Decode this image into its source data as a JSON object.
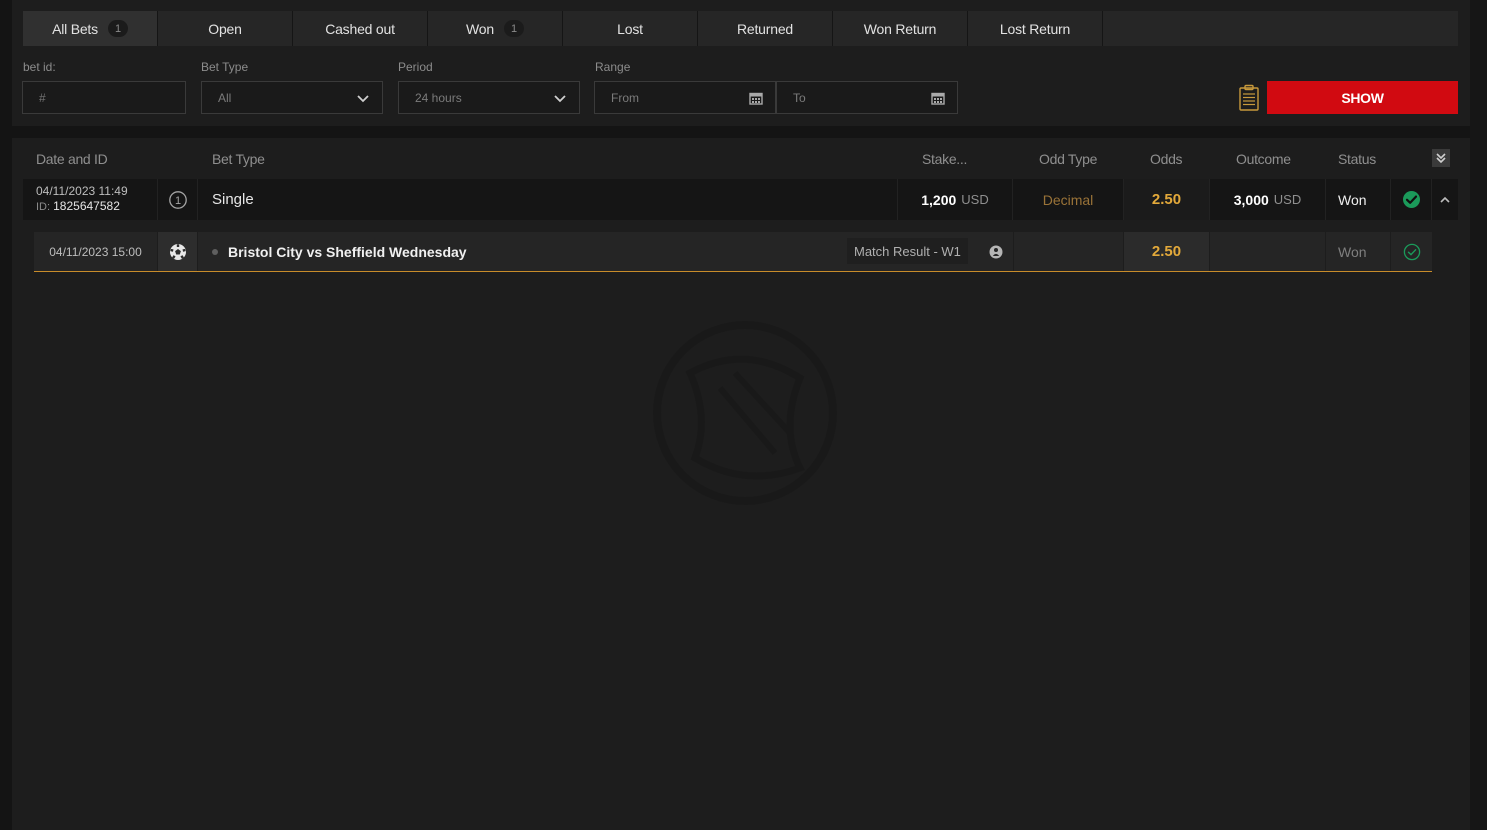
{
  "tabs": [
    {
      "label": "All Bets",
      "count": "1",
      "active": true
    },
    {
      "label": "Open"
    },
    {
      "label": "Cashed out"
    },
    {
      "label": "Won",
      "count": "1"
    },
    {
      "label": "Lost"
    },
    {
      "label": "Returned"
    },
    {
      "label": "Won Return"
    },
    {
      "label": "Lost Return"
    }
  ],
  "filters": {
    "bet_id_label": "bet id:",
    "bet_id_placeholder": "#",
    "bet_type_label": "Bet Type",
    "bet_type_value": "All",
    "period_label": "Period",
    "period_value": "24 hours",
    "range_label": "Range",
    "from_placeholder": "From",
    "to_placeholder": "To",
    "show_label": "SHOW"
  },
  "table": {
    "headers": {
      "date_id": "Date and ID",
      "bet_type": "Bet Type",
      "stake": "Stake...",
      "odd_type": "Odd Type",
      "odds": "Odds",
      "outcome": "Outcome",
      "status": "Status"
    },
    "bet": {
      "datetime": "04/11/2023 11:49",
      "id_label": "ID:",
      "id": "1825647582",
      "events_count": "1",
      "type": "Single",
      "stake": "1,200",
      "currency": "USD",
      "odd_type": "Decimal",
      "odds": "2.50",
      "outcome": "3,000",
      "status": "Won"
    },
    "event": {
      "datetime": "04/11/2023 15:00",
      "sport_icon": "soccer-ball-icon",
      "name": "Bristol City vs Sheffield Wednesday",
      "market": "Match Result - W1",
      "odds": "2.50",
      "status": "Won"
    }
  },
  "colors": {
    "accent": "#d10a11",
    "odds": "#e3a93a",
    "won": "#1b9a5a",
    "divider": "#c88c2a"
  }
}
